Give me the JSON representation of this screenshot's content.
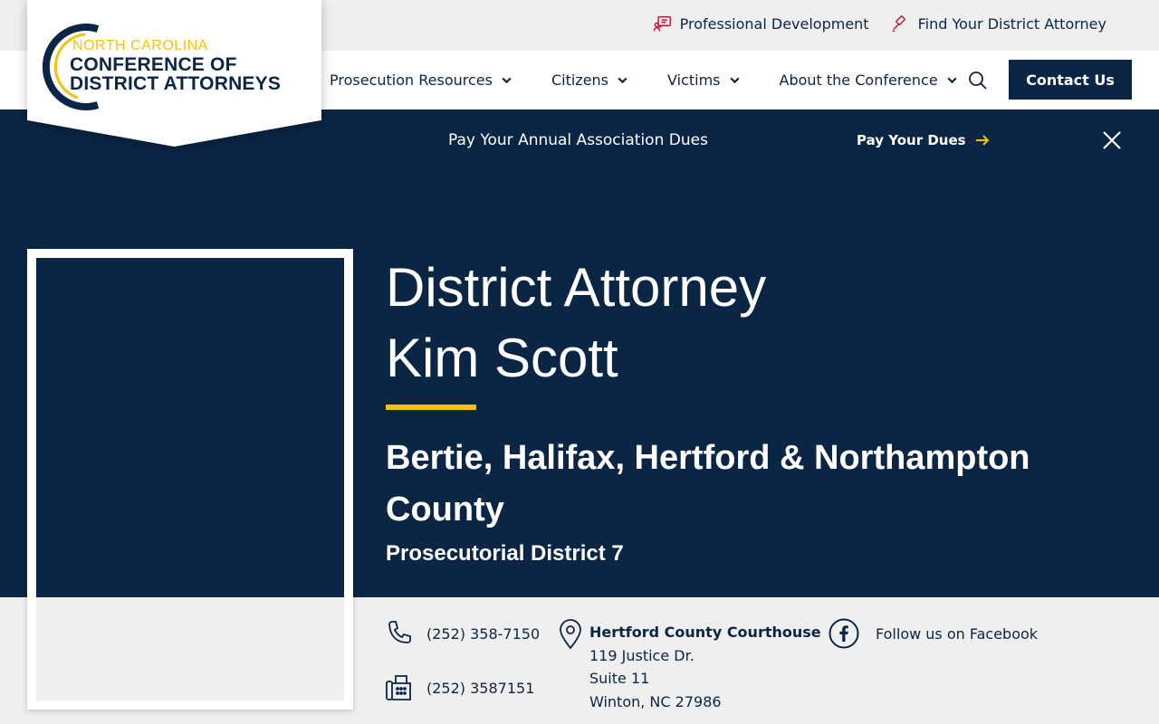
{
  "logo": {
    "line1": "NORTH CAROLINA",
    "line2": "CONFERENCE OF",
    "line3": "DISTRICT ATTORNEYS"
  },
  "utility": {
    "links": [
      {
        "label": "Professional Development",
        "icon": "presenter-icon"
      },
      {
        "label": "Find Your District Attorney",
        "icon": "gavel-icon"
      }
    ]
  },
  "nav": {
    "items": [
      {
        "label": "Prosecution Resources"
      },
      {
        "label": "Citizens"
      },
      {
        "label": "Victims"
      },
      {
        "label": "About the Conference"
      }
    ],
    "contact_label": "Contact Us"
  },
  "banner": {
    "text": "Pay Your Annual Association Dues",
    "link_label": "Pay Your Dues"
  },
  "hero": {
    "title_line1": "District Attorney",
    "title_line2": "Kim Scott",
    "county": "Bertie, Halifax, Hertford & Northampton County",
    "district": "Prosecutorial District 7"
  },
  "contact": {
    "phone": "(252) 358-7150",
    "fax": "(252) 3587151",
    "address": {
      "title": "Hertford County Courthouse",
      "line1": "119 Justice Dr.",
      "line2": "Suite 11",
      "line3": "Winton, NC 27986"
    },
    "facebook_label": "Follow us on Facebook"
  },
  "colors": {
    "navy": "#0b2545",
    "gold": "#f4c20d",
    "light_gray": "#efefef",
    "accent_red": "#c8102e"
  }
}
